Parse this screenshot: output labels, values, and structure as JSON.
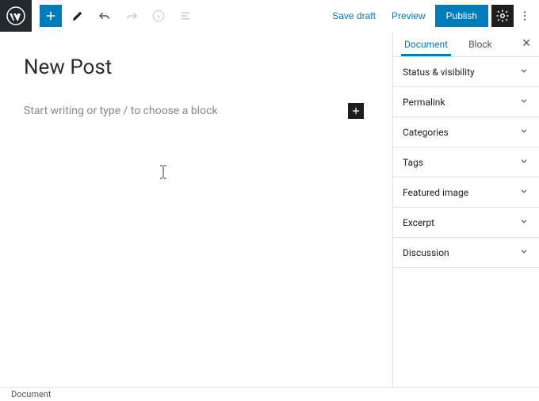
{
  "toolbar": {
    "save_draft": "Save draft",
    "preview": "Preview",
    "publish": "Publish"
  },
  "editor": {
    "title": "New Post",
    "content_placeholder": "Start writing or type / to choose a block"
  },
  "sidebar": {
    "tabs": {
      "document": "Document",
      "block": "Block"
    },
    "active_tab": "document",
    "panels": [
      {
        "label": "Status & visibility"
      },
      {
        "label": "Permalink"
      },
      {
        "label": "Categories"
      },
      {
        "label": "Tags"
      },
      {
        "label": "Featured image"
      },
      {
        "label": "Excerpt"
      },
      {
        "label": "Discussion"
      }
    ]
  },
  "footer": {
    "breadcrumb": "Document"
  }
}
